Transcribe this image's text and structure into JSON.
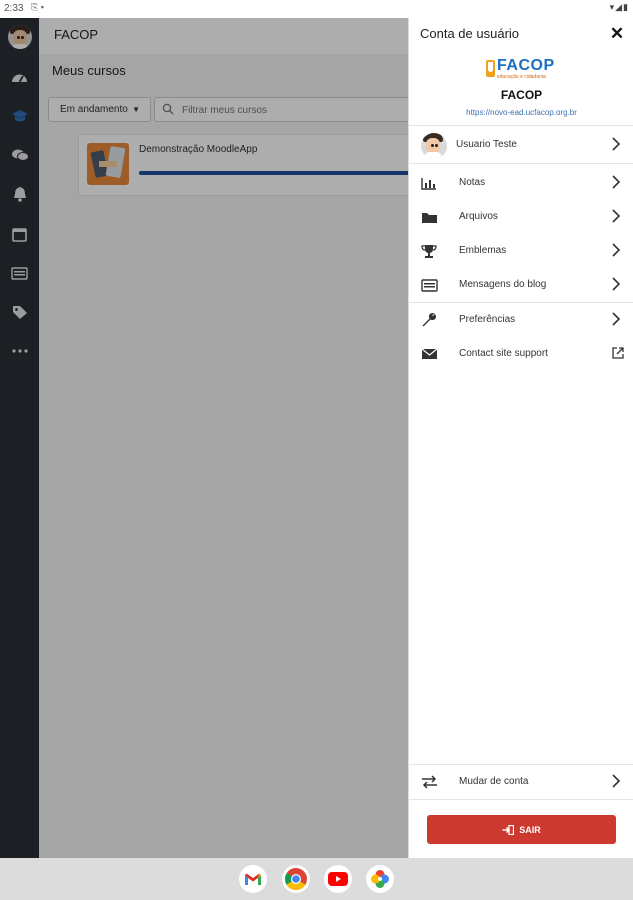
{
  "status_bar": {
    "time": "2:33"
  },
  "rail": {
    "items": [
      "avatar",
      "dashboard-icon",
      "courses-icon",
      "messages-icon",
      "notifications-icon",
      "calendar-icon",
      "blog-icon",
      "tags-icon",
      "more-icon"
    ],
    "active": "courses-icon"
  },
  "main": {
    "app_title": "FACOP",
    "heading": "Meus cursos",
    "filter_select": "Em andamento",
    "search_placeholder": "Filtrar meus cursos",
    "course": {
      "name": "Demonstração MoodleApp",
      "progress": 1.0
    }
  },
  "drawer": {
    "title": "Conta de usuário",
    "site_name": "FACOP",
    "site_url": "https://novo-ead.ucfacop.org.br",
    "logo": {
      "word": "FACOP",
      "tagline": "educação e cidadania"
    },
    "user_name": "Usuario Teste",
    "items": [
      {
        "icon": "grades-icon",
        "label": "Notas"
      },
      {
        "icon": "folder-icon",
        "label": "Arquivos"
      },
      {
        "icon": "trophy-icon",
        "label": "Emblemas"
      },
      {
        "icon": "blog-icon",
        "label": "Mensagens do blog"
      },
      {
        "icon": "wrench-icon",
        "label": "Preferências"
      },
      {
        "icon": "envelope-icon",
        "label": "Contact site support"
      }
    ],
    "switch_account": "Mudar de conta",
    "logout": "SAIR"
  },
  "colors": {
    "rail_bg": "#2a2f35",
    "rail_active": "#2e6fb8",
    "progress": "#1c4f9c",
    "logout": "#cc3a2f",
    "link": "#3a6fb5"
  },
  "taskbar": {
    "apps": [
      "gmail-icon",
      "chrome-icon",
      "youtube-icon",
      "photos-icon"
    ]
  }
}
